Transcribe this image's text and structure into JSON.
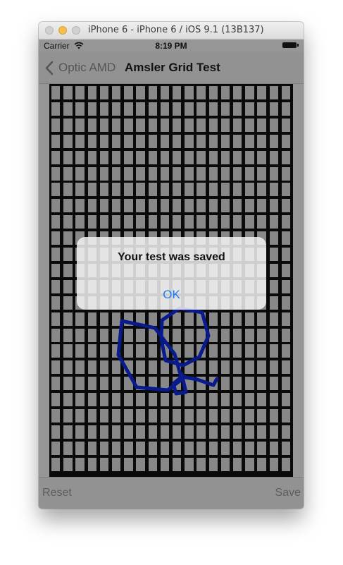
{
  "window": {
    "title": "iPhone 6 - iPhone 6 / iOS 9.1 (13B137)"
  },
  "status_bar": {
    "carrier": "Carrier",
    "time": "8:19 PM",
    "wifi_icon": "wifi-icon",
    "battery_icon": "battery-icon"
  },
  "nav": {
    "back_label": "Optic AMD",
    "title": "Amsler Grid Test"
  },
  "toolbar": {
    "reset_label": "Reset",
    "save_label": "Save"
  },
  "alert": {
    "title": "Your test was saved",
    "ok_label": "OK"
  },
  "colors": {
    "accent": "#1b7af5",
    "drawing_stroke": "#081a8c",
    "grid_lines": "#0a0a0a",
    "grid_cells": "#888888"
  }
}
